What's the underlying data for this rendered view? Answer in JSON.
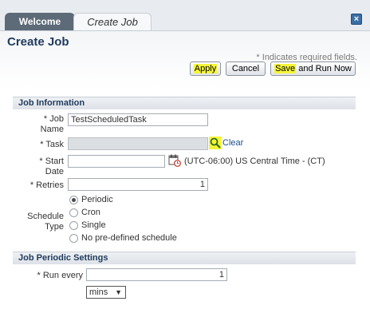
{
  "tabs": {
    "welcome": "Welcome",
    "create_job": "Create Job"
  },
  "page": {
    "title": "Create Job",
    "required_note": "* Indicates required fields."
  },
  "toolbar": {
    "apply": "Apply",
    "cancel": "Cancel",
    "save_hl": "Save",
    "save_rest": " and Run Now"
  },
  "job_info": {
    "section_title": "Job Information",
    "job_name_label_1": "* Job",
    "job_name_label_2": "Name",
    "job_name_value": "TestScheduledTask",
    "task_label": "* Task",
    "task_value": "",
    "clear_link": "Clear",
    "start_date_label_1": "* Start",
    "start_date_label_2": "Date",
    "start_date_value": "",
    "timezone": "(UTC-06:00) US Central Time - (CT)",
    "retries_label": "* Retries",
    "retries_value": "1",
    "schedule_type_label_1": "Schedule",
    "schedule_type_label_2": "Type",
    "schedule_options": [
      "Periodic",
      "Cron",
      "Single",
      "No pre-defined schedule"
    ],
    "schedule_selected": "Periodic"
  },
  "periodic": {
    "section_title": "Job Periodic Settings",
    "run_every_label": "* Run every",
    "run_every_value": "1",
    "unit_value": "mins"
  }
}
